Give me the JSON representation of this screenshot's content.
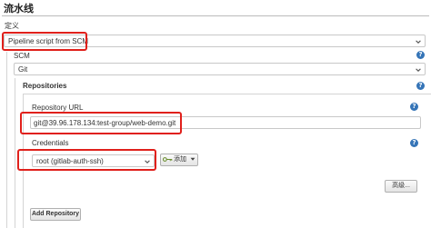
{
  "section": {
    "title": "流水线",
    "definition_label": "定义",
    "definition_value": "Pipeline script from SCM"
  },
  "scm": {
    "label": "SCM",
    "value": "Git"
  },
  "repositories": {
    "label": "Repositories",
    "url_label": "Repository URL",
    "url_value": "git@39.96.178.134:test-group/web-demo.git",
    "credentials_label": "Credentials",
    "credentials_value": "root (gitlab-auth-ssh)",
    "add_credentials_label": "添加",
    "advanced_label": "高级...",
    "add_repository_label": "Add Repository"
  },
  "help_glyph": "?",
  "colors": {
    "highlight": "#e0201b",
    "help_icon": "#3574b7",
    "key_icon": "#6a8e2e"
  }
}
